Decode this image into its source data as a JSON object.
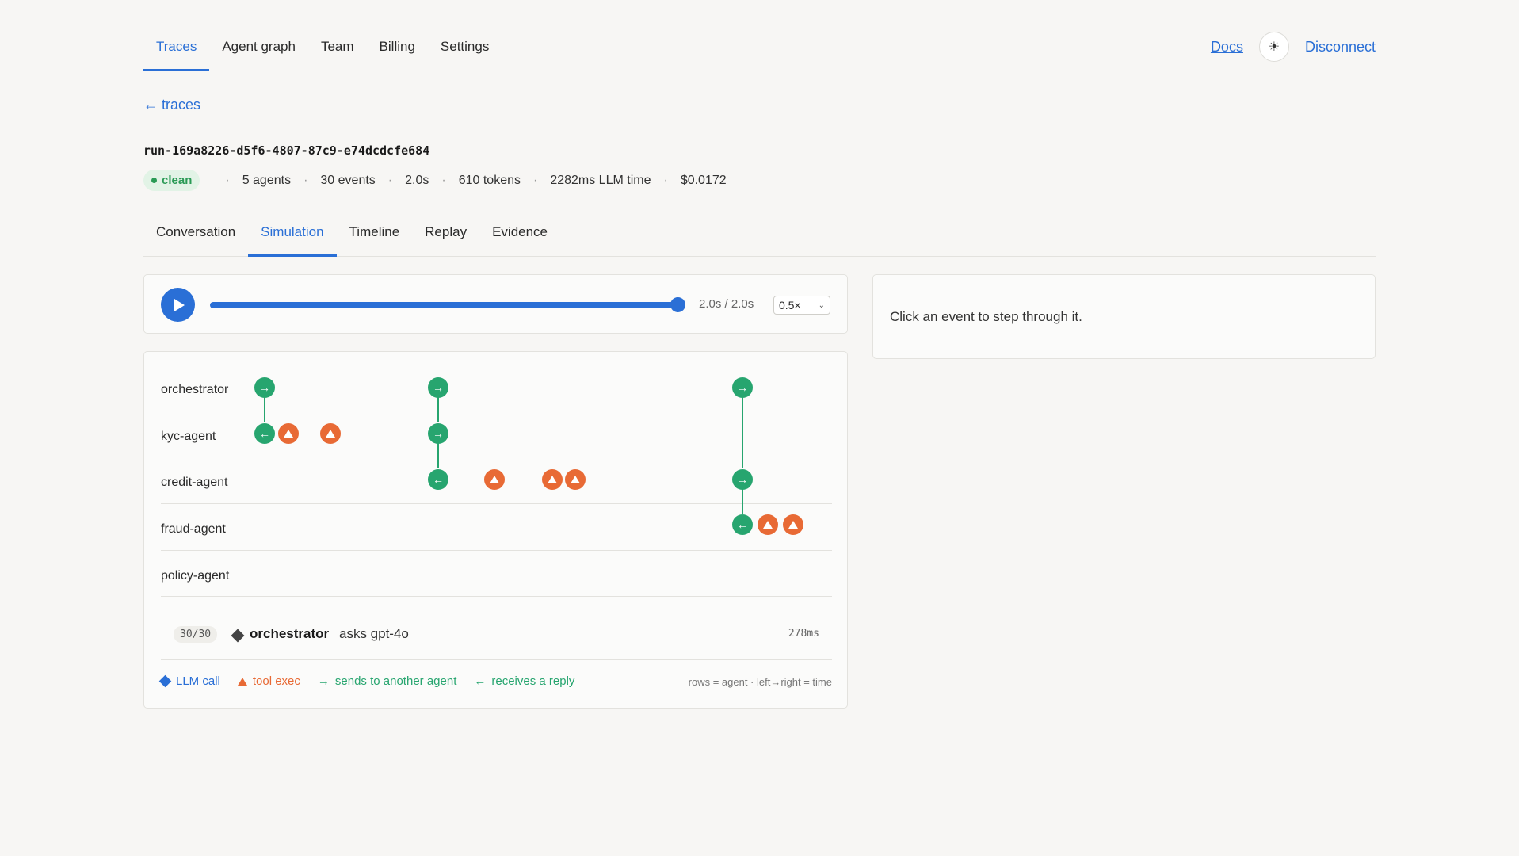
{
  "nav": {
    "tabs": [
      "Traces",
      "Agent graph",
      "Team",
      "Billing",
      "Settings"
    ],
    "docs": "Docs",
    "theme_icon": "☀",
    "disconnect": "Disconnect"
  },
  "back_link": "← traces",
  "run": {
    "id": "run-169a8226-d5f6-4807-87c9-e74dcdcfe684",
    "status": "clean",
    "agents": "5 agents",
    "events": "30 events",
    "duration": "2.0s",
    "tokens": "610 tokens",
    "llm_time": "2282ms LLM time",
    "cost": "$0.0172"
  },
  "subtabs": [
    "Conversation",
    "Simulation",
    "Timeline",
    "Replay",
    "Evidence"
  ],
  "player": {
    "progress": 1.0,
    "time": "2.0s / 2.0s",
    "speed": "0.5×"
  },
  "side_hint": "Click an event to step through it.",
  "lanes": [
    "orchestrator",
    "kyc-agent",
    "credit-agent",
    "fraud-agent",
    "policy-agent"
  ],
  "event_glyphs": {
    "send": "→",
    "recv": "←"
  },
  "detail": {
    "counter": "30/30",
    "actor": "orchestrator",
    "action": "asks gpt-4o",
    "duration": "278ms"
  },
  "legend": {
    "llm": "LLM call",
    "tool": "tool exec",
    "send": "sends to another agent",
    "recv": "receives a reply",
    "note": "rows = agent · left→right = time"
  },
  "colors": {
    "accent": "#2a6fd6",
    "message": "#27a56f",
    "tool": "#e86a35"
  }
}
